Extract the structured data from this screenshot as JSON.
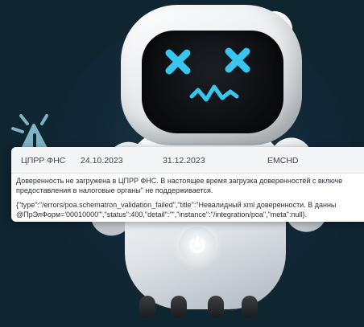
{
  "error_row": {
    "authority": "ЦПРР ФНС",
    "date_from": "24.10.2023",
    "date_to": "31.12.2023",
    "format": "EMCHD"
  },
  "error_message": {
    "line1": "Доверенность не загружена в ЦПРР ФНС. В настоящее время загрузка доверенностей с включе",
    "line2": "предоставления в налоговые органы\" не поддерживается."
  },
  "error_json": {
    "line1": "{\"type\":\"/errors/poa.schematron_validation_failed\",\"title\":\"Невалидный xml доверенности. В данны",
    "line2": "@ПрЭлФорм='00010000'\",\"status\":400,\"detail\":\"\",\"instance\":\"/integration/poa\",\"meta\":null}."
  },
  "colors": {
    "background": "#0f2530",
    "robot_eyes": "#38c6ee",
    "warning": "#7fb4c6"
  },
  "icons": {
    "warning": "warning-triangle-icon",
    "power": "power-icon"
  }
}
